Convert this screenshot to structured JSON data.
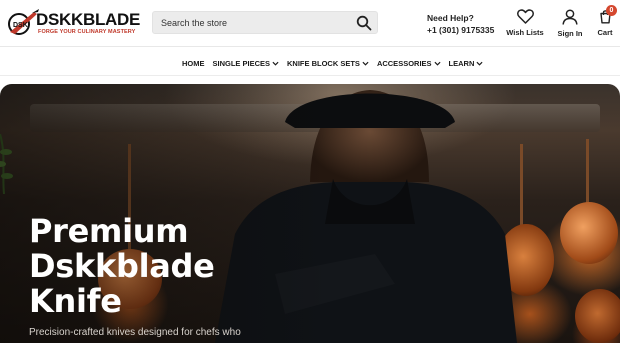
{
  "brand": {
    "name": "DSKKBLADE",
    "tagline": "FORGE YOUR CULINARY MASTERY",
    "accent": "#c0392b"
  },
  "search": {
    "placeholder": "Search the store",
    "icon": "search-icon"
  },
  "help": {
    "title": "Need Help?",
    "phone": "+1 (301) 9175335"
  },
  "header_actions": {
    "wishlist_label": "Wish Lists",
    "signin_label": "Sign In",
    "cart_label": "Cart",
    "cart_count": "0"
  },
  "nav": {
    "items": [
      {
        "label": "HOME",
        "dropdown": false
      },
      {
        "label": "SINGLE PIECES",
        "dropdown": true
      },
      {
        "label": "KNIFE BLOCK SETS",
        "dropdown": true
      },
      {
        "label": "ACCESSORIES",
        "dropdown": true
      },
      {
        "label": "LEARN",
        "dropdown": true
      }
    ]
  },
  "hero": {
    "title": "Premium Dskkblade Knife",
    "subtitle": "Precision-crafted knives designed for chefs who"
  },
  "colors": {
    "badge": "#d4472e",
    "text": "#222222",
    "hero_text": "#ffffff"
  }
}
